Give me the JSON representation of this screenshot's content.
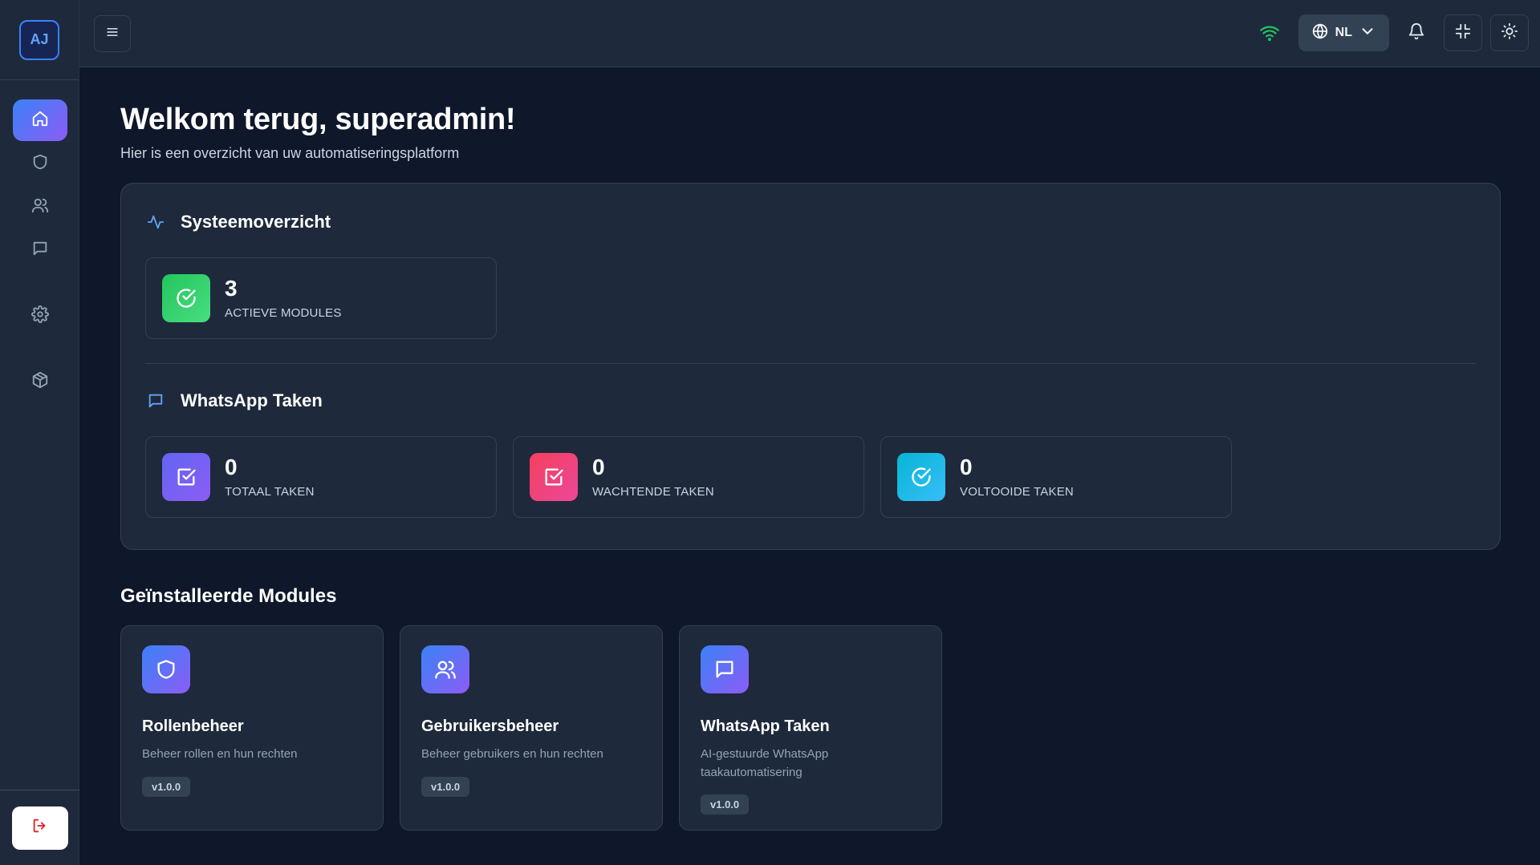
{
  "sidebar": {
    "avatar_initials": "AJ",
    "items": [
      {
        "name": "home",
        "icon": "home-icon",
        "active": true
      },
      {
        "name": "roles",
        "icon": "shield-icon"
      },
      {
        "name": "users",
        "icon": "users-icon"
      },
      {
        "name": "whatsapp",
        "icon": "message-icon"
      },
      {
        "name": "settings",
        "icon": "gear-icon"
      },
      {
        "name": "modules",
        "icon": "package-icon"
      }
    ],
    "logout_icon": "logout-icon"
  },
  "topbar": {
    "language": "NL",
    "status_color": "#22c55e"
  },
  "page": {
    "title": "Welkom terug, superadmin!",
    "subtitle": "Hier is een overzicht van uw automatiseringsplatform"
  },
  "overview": {
    "system": {
      "title": "Systeemoverzicht",
      "stats": [
        {
          "value": "3",
          "label": "ACTIEVE MODULES"
        }
      ]
    },
    "whatsapp": {
      "title": "WhatsApp Taken",
      "stats": [
        {
          "value": "0",
          "label": "TOTAAL TAKEN"
        },
        {
          "value": "0",
          "label": "WACHTENDE TAKEN"
        },
        {
          "value": "0",
          "label": "VOLTOOIDE TAKEN"
        }
      ]
    }
  },
  "modules": {
    "title": "Geïnstalleerde Modules",
    "items": [
      {
        "name": "Rollenbeheer",
        "description": "Beheer rollen en hun rechten",
        "version": "v1.0.0"
      },
      {
        "name": "Gebruikersbeheer",
        "description": "Beheer gebruikers en hun rechten",
        "version": "v1.0.0"
      },
      {
        "name": "WhatsApp Taken",
        "description": "AI-gestuurde WhatsApp taakautomatisering",
        "version": "v1.0.0"
      }
    ]
  },
  "colors": {
    "background": "#0f172a",
    "surface": "#1e293b",
    "accent": "#3b82f6",
    "accent_secondary": "#8b5cf6"
  }
}
